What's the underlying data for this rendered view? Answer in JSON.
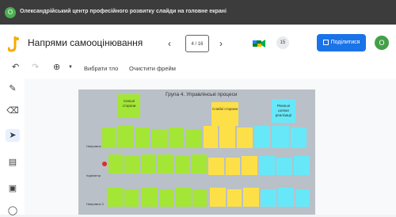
{
  "notification": {
    "text": "Олександрійський центр професійного розвитку слайди на головне екрані",
    "avatar_letter": "O"
  },
  "header": {
    "title": "Напрями самооцінювання",
    "frame_indicator": "4 / 16",
    "participants_count": "15",
    "share_label": "Поділитися",
    "user_avatar_letter": "О"
  },
  "toolbar": {
    "set_background": "Вибрати тло",
    "clear_frame": "Очистити фрейм"
  },
  "sidebar": {
    "tools": [
      "pen-icon",
      "eraser-icon",
      "cursor-icon",
      "sticky-note-icon",
      "image-icon",
      "circle-icon"
    ]
  },
  "board": {
    "title": "Група 4. Управлінські процеси",
    "headers": {
      "strengths": "Сильні сторони",
      "weaknesses": "Слабкі сторони",
      "recommendations": "Реальні шляхи реалізації"
    },
    "row_labels": [
      "Напрямок 1",
      "Індикатор",
      "Напрямок 3"
    ]
  },
  "colors": {
    "green": "#a3e635",
    "yellow": "#fde047",
    "cyan": "#67e8f9",
    "share": "#1a73e8"
  }
}
